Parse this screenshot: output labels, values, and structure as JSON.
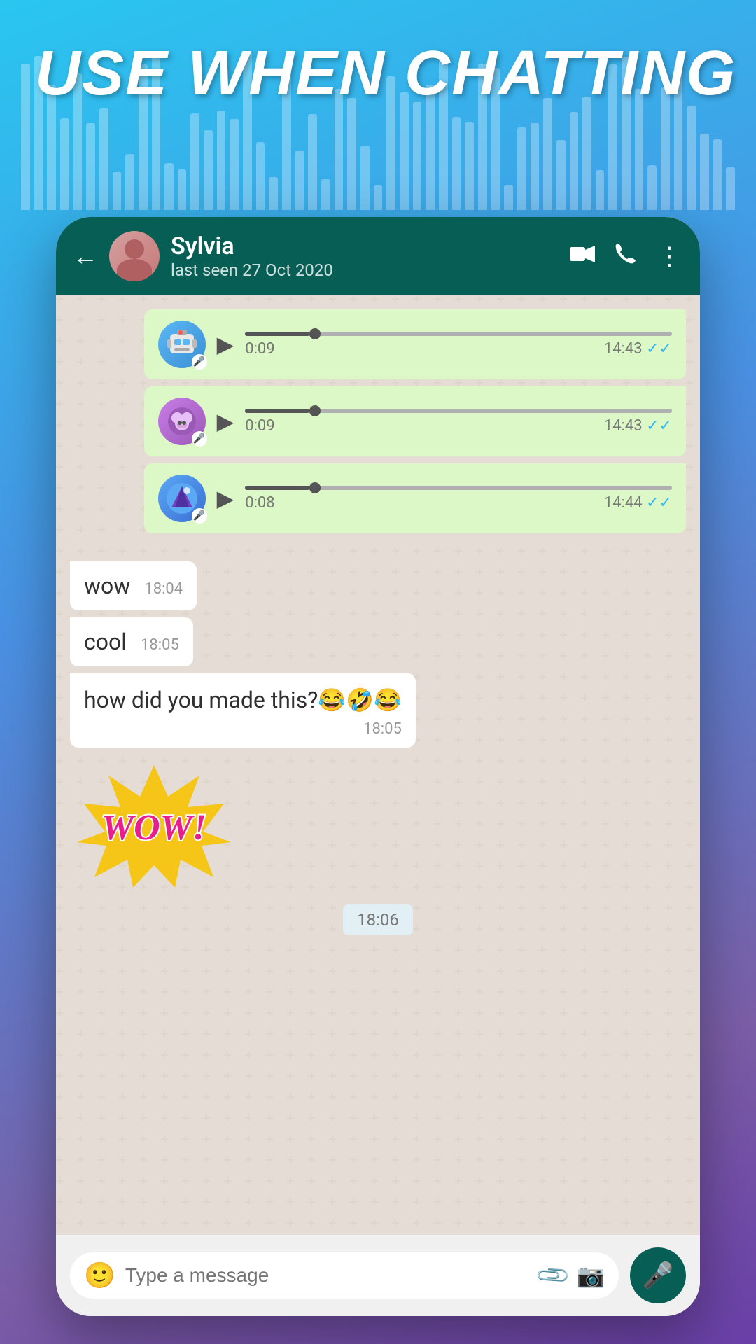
{
  "header": {
    "title": "USE WHEN CHATTING"
  },
  "chat": {
    "contact": {
      "name": "Sylvia",
      "status": "last seen 27 Oct 2020"
    },
    "voice_messages": [
      {
        "id": "vm1",
        "avatar_type": "robot",
        "avatar_emoji": "🤖",
        "duration": "0:09",
        "time": "14:43",
        "progress": 15
      },
      {
        "id": "vm2",
        "avatar_type": "sheep",
        "avatar_emoji": "🐑",
        "duration": "0:09",
        "time": "14:43",
        "progress": 15
      },
      {
        "id": "vm3",
        "avatar_type": "mountain",
        "avatar_emoji": "⛺",
        "duration": "0:08",
        "time": "14:44",
        "progress": 15
      }
    ],
    "messages": [
      {
        "id": "msg1",
        "type": "received_short",
        "text": "wow",
        "time": "18:04"
      },
      {
        "id": "msg2",
        "type": "received_short",
        "text": "cool",
        "time": "18:05"
      },
      {
        "id": "msg3",
        "type": "received_long",
        "text": "how did you made this?😂🤣😂",
        "time": "18:05"
      },
      {
        "id": "msg4",
        "type": "sticker",
        "time": "18:06"
      }
    ],
    "input": {
      "placeholder": "Type a message"
    },
    "time_divider": "18:06"
  }
}
